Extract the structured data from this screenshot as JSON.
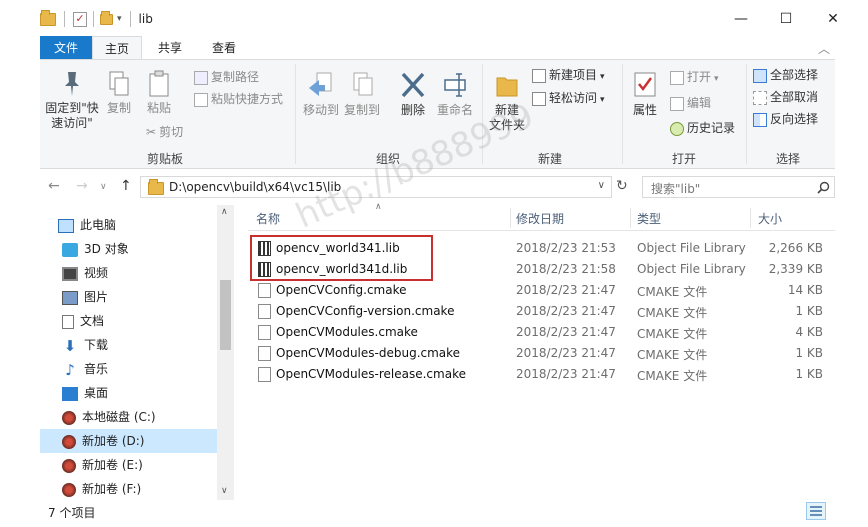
{
  "window": {
    "title": "lib",
    "minimize": "—",
    "maximize": "☐",
    "close": "✕"
  },
  "tabs": [
    {
      "label": "文件"
    },
    {
      "label": "主页"
    },
    {
      "label": "共享"
    },
    {
      "label": "查看"
    }
  ],
  "ribbon": {
    "clipboard": {
      "label": "剪贴板",
      "pin_line1": "固定到\"快",
      "pin_line2": "速访问\"",
      "copy": "复制",
      "paste": "粘贴",
      "copy_path": "复制路径",
      "paste_shortcut": "粘贴快捷方式",
      "cut": "剪切"
    },
    "organize": {
      "label": "组织",
      "move_to": "移动到",
      "copy_to": "复制到",
      "delete": "删除",
      "rename": "重命名"
    },
    "new": {
      "label": "新建",
      "new_folder_line1": "新建",
      "new_folder_line2": "文件夹",
      "new_item": "新建项目",
      "easy_access": "轻松访问"
    },
    "open": {
      "label": "打开",
      "properties": "属性",
      "open": "打开",
      "edit": "编辑",
      "history": "历史记录"
    },
    "select": {
      "label": "选择",
      "select_all": "全部选择",
      "select_none": "全部取消",
      "invert": "反向选择"
    }
  },
  "address": {
    "path": "D:\\opencv\\build\\x64\\vc15\\lib",
    "search_placeholder": "搜索\"lib\""
  },
  "nav": [
    {
      "label": "此电脑",
      "icon": "computer-icon"
    },
    {
      "label": "3D 对象",
      "icon": "cube-icon"
    },
    {
      "label": "视频",
      "icon": "video-icon"
    },
    {
      "label": "图片",
      "icon": "picture-icon"
    },
    {
      "label": "文档",
      "icon": "document-icon"
    },
    {
      "label": "下载",
      "icon": "download-icon"
    },
    {
      "label": "音乐",
      "icon": "music-icon"
    },
    {
      "label": "桌面",
      "icon": "desktop-icon"
    },
    {
      "label": "本地磁盘 (C:)",
      "icon": "disk-icon"
    },
    {
      "label": "新加卷 (D:)",
      "icon": "disk-icon"
    },
    {
      "label": "新加卷 (E:)",
      "icon": "disk-icon"
    },
    {
      "label": "新加卷 (F:)",
      "icon": "disk-icon"
    }
  ],
  "columns": {
    "name": "名称",
    "date": "修改日期",
    "type": "类型",
    "size": "大小"
  },
  "files": [
    {
      "name": "opencv_world341.lib",
      "date": "2018/2/23 21:53",
      "type": "Object File Library",
      "size": "2,266 KB",
      "icon": "library-icon"
    },
    {
      "name": "opencv_world341d.lib",
      "date": "2018/2/23 21:58",
      "type": "Object File Library",
      "size": "2,339 KB",
      "icon": "library-icon"
    },
    {
      "name": "OpenCVConfig.cmake",
      "date": "2018/2/23 21:47",
      "type": "CMAKE 文件",
      "size": "14 KB",
      "icon": "file-icon"
    },
    {
      "name": "OpenCVConfig-version.cmake",
      "date": "2018/2/23 21:47",
      "type": "CMAKE 文件",
      "size": "1 KB",
      "icon": "file-icon"
    },
    {
      "name": "OpenCVModules.cmake",
      "date": "2018/2/23 21:47",
      "type": "CMAKE 文件",
      "size": "4 KB",
      "icon": "file-icon"
    },
    {
      "name": "OpenCVModules-debug.cmake",
      "date": "2018/2/23 21:47",
      "type": "CMAKE 文件",
      "size": "1 KB",
      "icon": "file-icon"
    },
    {
      "name": "OpenCVModules-release.cmake",
      "date": "2018/2/23 21:47",
      "type": "CMAKE 文件",
      "size": "1 KB",
      "icon": "file-icon"
    }
  ],
  "status": {
    "count": "7 个项目"
  },
  "watermark": "http://b888999",
  "colors": {
    "accent": "#1979ca",
    "selection": "#cce8ff",
    "highlight": "#c8302e"
  }
}
